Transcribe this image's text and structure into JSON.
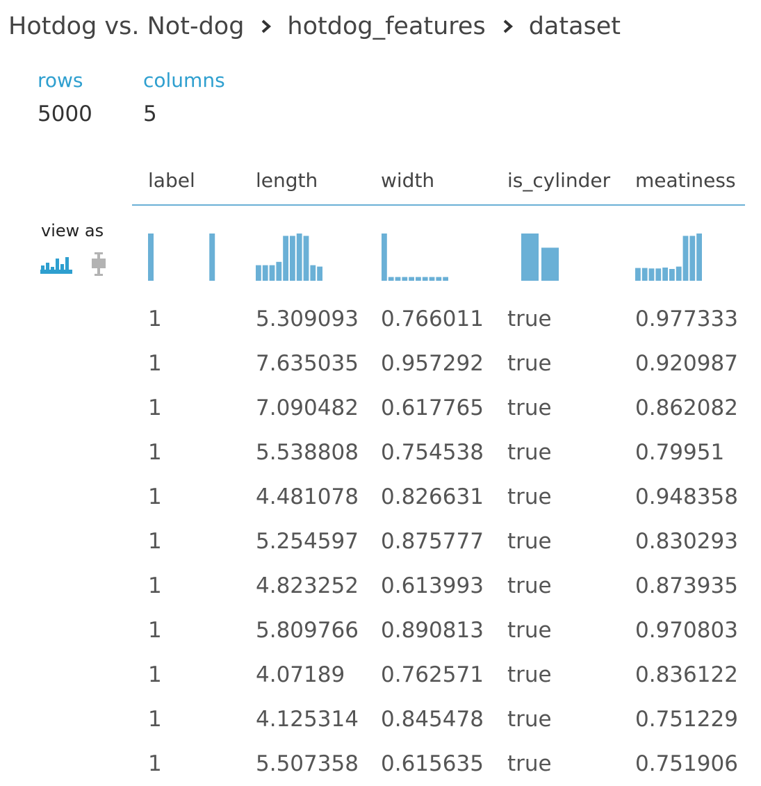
{
  "breadcrumb": {
    "items": [
      "Hotdog vs. Not-dog",
      "hotdog_features",
      "dataset"
    ]
  },
  "stats": {
    "rows_label": "rows",
    "rows_value": "5000",
    "columns_label": "columns",
    "columns_value": "5"
  },
  "view_as": {
    "label": "view as",
    "options": [
      {
        "icon": "histogram-icon",
        "selected": true
      },
      {
        "icon": "boxplot-icon",
        "selected": false
      }
    ]
  },
  "colors": {
    "accent": "#2e9fcf",
    "histogram": "#6ab0d6",
    "inactive_icon": "#b3b3b3",
    "text": "#444444"
  },
  "table": {
    "columns": [
      "label",
      "length",
      "width",
      "is_cylinder",
      "meatiness"
    ],
    "histograms": [
      [
        1,
        0,
        0,
        0,
        0,
        0,
        0,
        0,
        0,
        1
      ],
      [
        0.33,
        0.33,
        0.33,
        0.4,
        0.95,
        0.95,
        1.0,
        0.95,
        0.33,
        0.3
      ],
      [
        1,
        0.08,
        0.08,
        0.08,
        0.08,
        0.08,
        0.08,
        0.08,
        0.08,
        0.08
      ],
      [
        1,
        0.7
      ],
      [
        0.27,
        0.27,
        0.26,
        0.26,
        0.28,
        0.25,
        0.3,
        0.95,
        0.95,
        1.0
      ]
    ],
    "rows": [
      [
        "1",
        "5.309093",
        "0.766011",
        "true",
        "0.977333"
      ],
      [
        "1",
        "7.635035",
        "0.957292",
        "true",
        "0.920987"
      ],
      [
        "1",
        "7.090482",
        "0.617765",
        "true",
        "0.862082"
      ],
      [
        "1",
        "5.538808",
        "0.754538",
        "true",
        "0.79951"
      ],
      [
        "1",
        "4.481078",
        "0.826631",
        "true",
        "0.948358"
      ],
      [
        "1",
        "5.254597",
        "0.875777",
        "true",
        "0.830293"
      ],
      [
        "1",
        "4.823252",
        "0.613993",
        "true",
        "0.873935"
      ],
      [
        "1",
        "5.809766",
        "0.890813",
        "true",
        "0.970803"
      ],
      [
        "1",
        "4.07189",
        "0.762571",
        "true",
        "0.836122"
      ],
      [
        "1",
        "4.125314",
        "0.845478",
        "true",
        "0.751229"
      ],
      [
        "1",
        "5.507358",
        "0.615635",
        "true",
        "0.751906"
      ]
    ]
  }
}
